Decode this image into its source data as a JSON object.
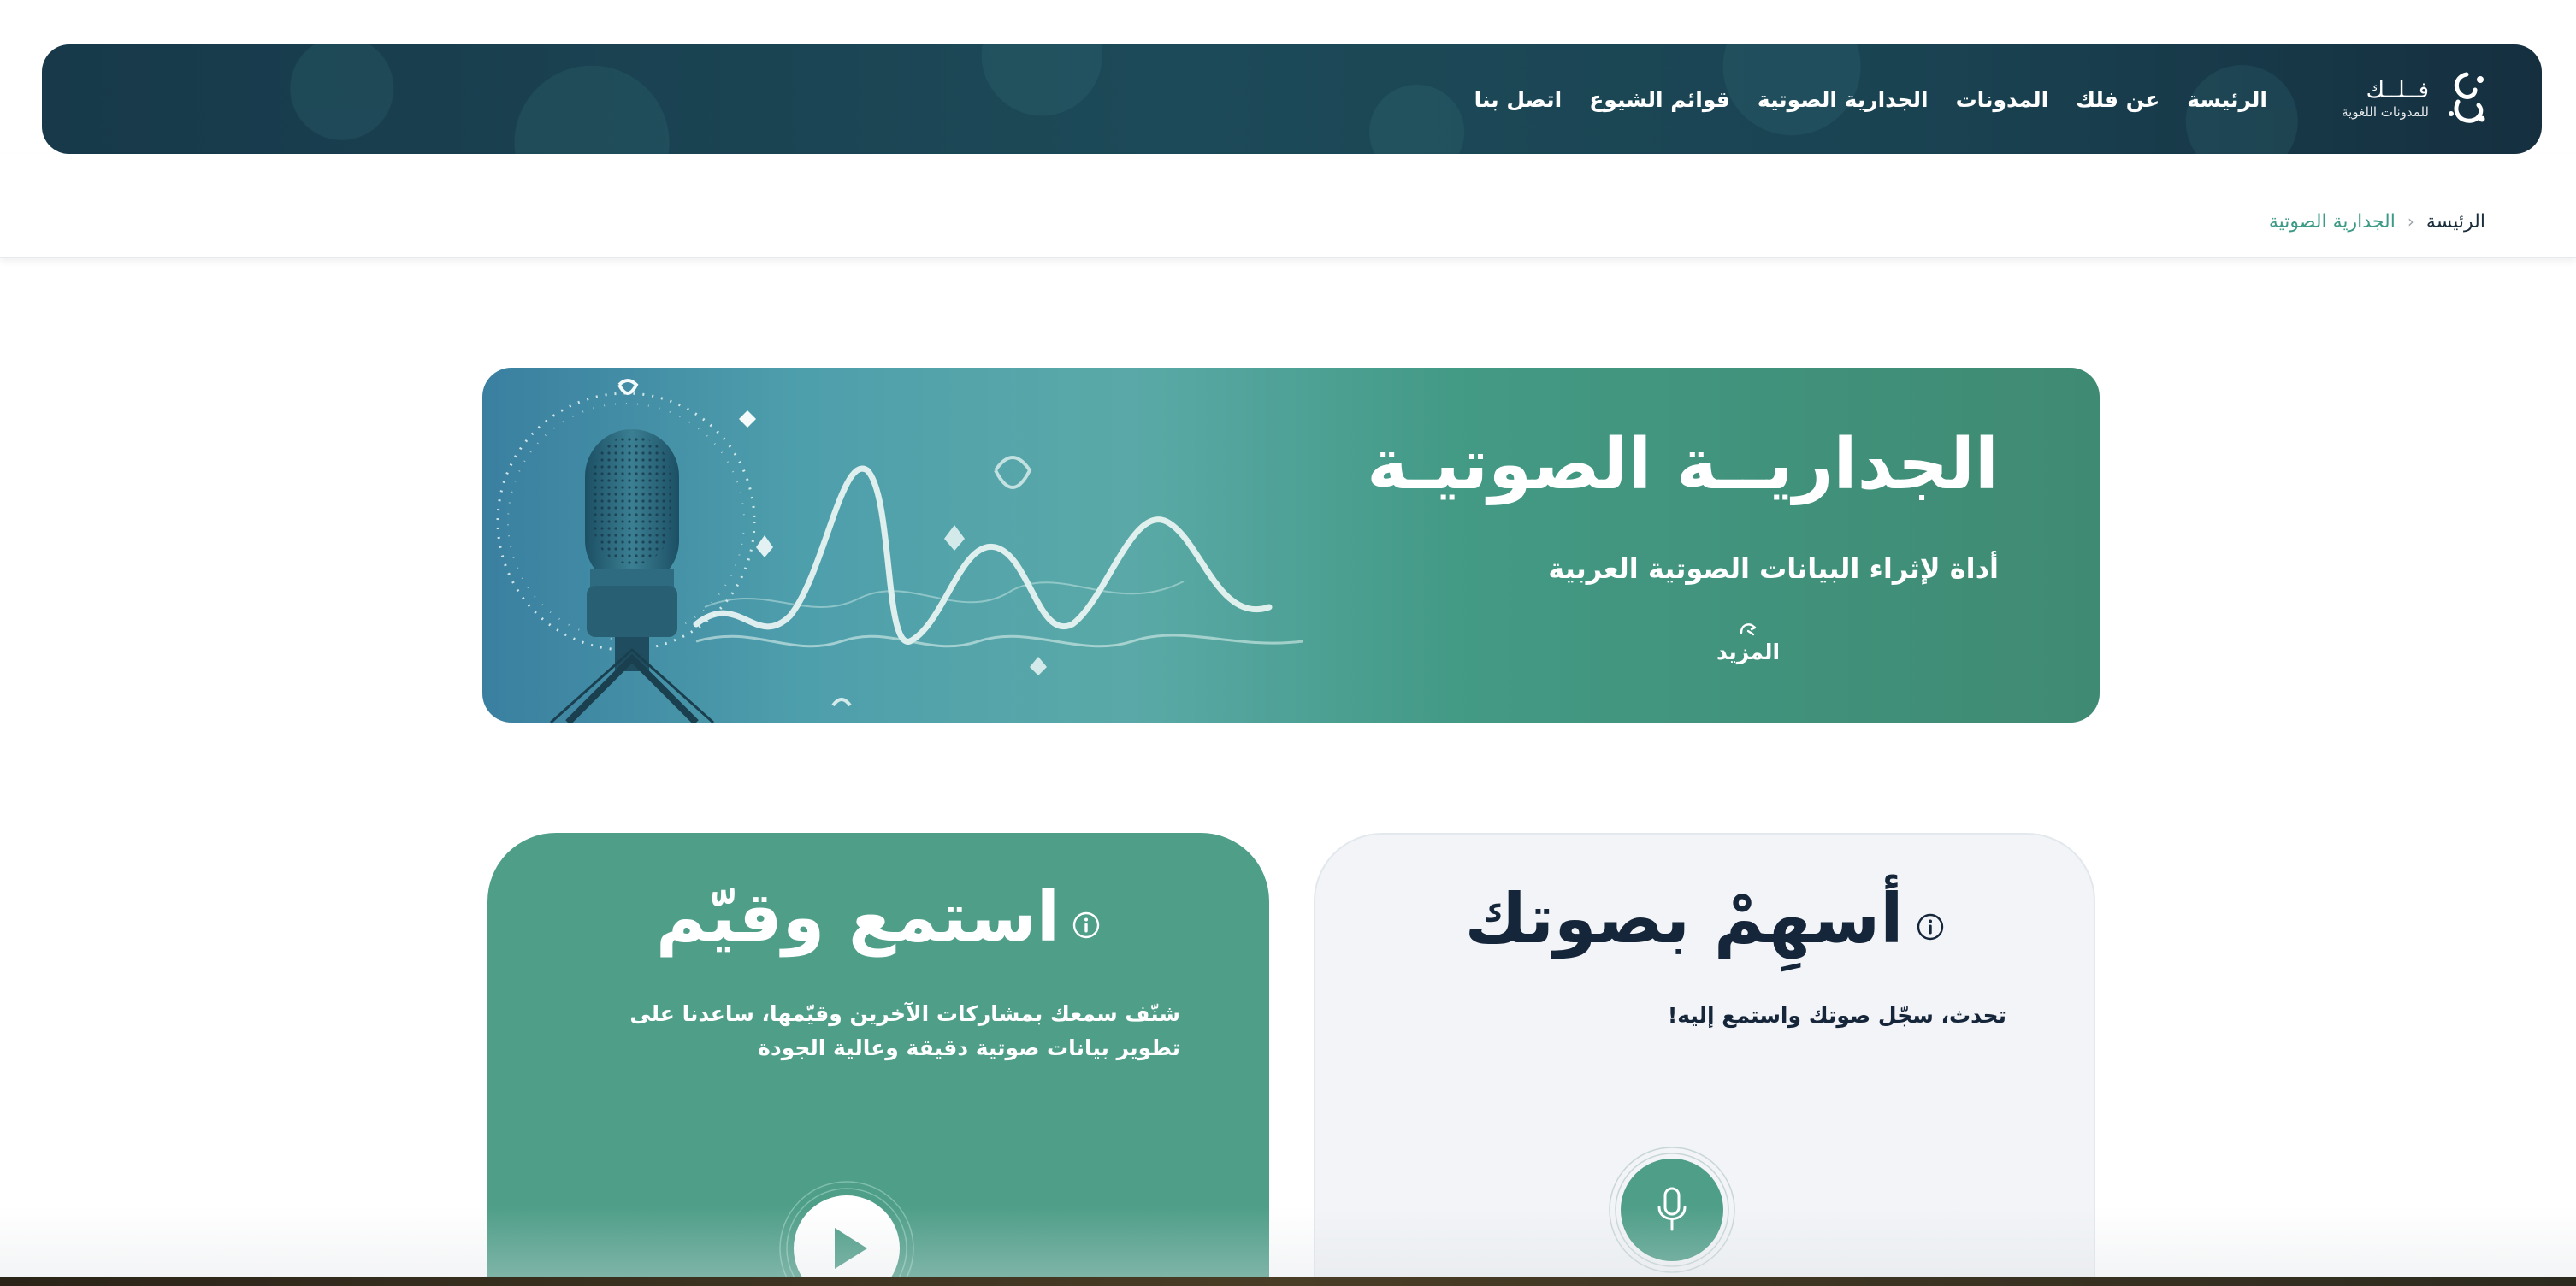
{
  "brand": {
    "name": "فــلــك",
    "tagline": "للمدونات اللغوية"
  },
  "nav": {
    "items": [
      {
        "label": "الرئيسة"
      },
      {
        "label": "عن فلك"
      },
      {
        "label": "المدونات"
      },
      {
        "label": "الجدارية الصوتية"
      },
      {
        "label": "قوائم الشيوع"
      },
      {
        "label": "اتصل بنا"
      }
    ]
  },
  "breadcrumb": {
    "home": "الرئيسة",
    "current": "الجدارية الصوتية"
  },
  "hero": {
    "title": "الجداريــة الصوتيـة",
    "subtitle": "أداة لإثراء البيانات الصوتية العربية",
    "more_label": "المزيد"
  },
  "cards": {
    "listen": {
      "title": "استمع وقيّم",
      "description": "شنّف سمعك بمشاركات الآخرين وقيّمها، ساعدنا على تطوير بيانات صوتية دقيقة وعالية الجودة"
    },
    "contribute": {
      "title": "أسهِمْ بصوتك",
      "description": "تحدث، سجّل صوتك واستمع إليه!"
    }
  },
  "colors": {
    "navbar": "#1a4352",
    "accent": "#3d9a86",
    "listen_card": "#4e9e88",
    "contribute_card": "#f2f4f7"
  },
  "icons": [
    "logo-mark-icon",
    "chevron-left-icon",
    "hand-pointer-icon",
    "info-icon",
    "play-icon",
    "microphone-icon"
  ]
}
